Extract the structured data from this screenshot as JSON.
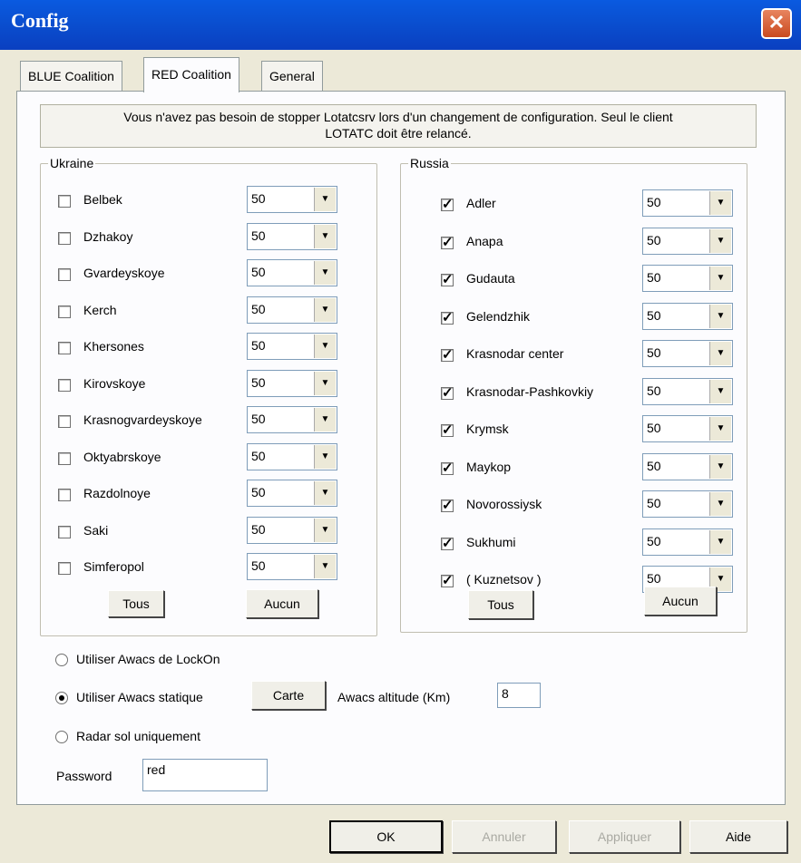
{
  "window": {
    "title": "Config",
    "close_glyph": "✕"
  },
  "tabs": [
    {
      "label": "BLUE Coalition",
      "active": false
    },
    {
      "label": "RED Coalition",
      "active": true
    },
    {
      "label": "General",
      "active": false
    }
  ],
  "info_text_line1": "Vous n'avez pas besoin de stopper Lotatcsrv lors d'un changement de configuration. Seul le client",
  "info_text_line2": "LOTATC doit être relancé.",
  "ukraine": {
    "legend": "Ukraine",
    "items": [
      {
        "label": "Belbek",
        "checked": false,
        "value": "50"
      },
      {
        "label": "Dzhakoy",
        "checked": false,
        "value": "50"
      },
      {
        "label": "Gvardeyskoye",
        "checked": false,
        "value": "50"
      },
      {
        "label": "Kerch",
        "checked": false,
        "value": "50"
      },
      {
        "label": "Khersones",
        "checked": false,
        "value": "50"
      },
      {
        "label": "Kirovskoye",
        "checked": false,
        "value": "50"
      },
      {
        "label": "Krasnogvardeyskoye",
        "checked": false,
        "value": "50"
      },
      {
        "label": "Oktyabrskoye",
        "checked": false,
        "value": "50"
      },
      {
        "label": "Razdolnoye",
        "checked": false,
        "value": "50"
      },
      {
        "label": "Saki",
        "checked": false,
        "value": "50"
      },
      {
        "label": "Simferopol",
        "checked": false,
        "value": "50"
      }
    ],
    "all_button": "Tous",
    "none_button": "Aucun"
  },
  "russia": {
    "legend": "Russia",
    "items": [
      {
        "label": "Adler",
        "checked": true,
        "value": "50"
      },
      {
        "label": "Anapa",
        "checked": true,
        "value": "50"
      },
      {
        "label": "Gudauta",
        "checked": true,
        "value": "50"
      },
      {
        "label": "Gelendzhik",
        "checked": true,
        "value": "50"
      },
      {
        "label": "Krasnodar center",
        "checked": true,
        "value": "50"
      },
      {
        "label": "Krasnodar-Pashkovkiy",
        "checked": true,
        "value": "50"
      },
      {
        "label": "Krymsk",
        "checked": true,
        "value": "50"
      },
      {
        "label": "Maykop",
        "checked": true,
        "value": "50"
      },
      {
        "label": "Novorossiysk",
        "checked": true,
        "value": "50"
      },
      {
        "label": "Sukhumi",
        "checked": true,
        "value": "50"
      },
      {
        "label": "( Kuznetsov )",
        "checked": true,
        "value": "50"
      }
    ],
    "all_button": "Tous",
    "none_button": "Aucun"
  },
  "options": {
    "radio_lockon": "Utiliser Awacs de LockOn",
    "radio_static": "Utiliser Awacs statique",
    "radio_ground": "Radar sol uniquement",
    "selected": "static",
    "map_button": "Carte",
    "altitude_label": "Awacs altitude (Km)",
    "altitude_value": "8",
    "password_label": "Password",
    "password_value": "red"
  },
  "footer": {
    "ok": "OK",
    "cancel": "Annuler",
    "apply": "Appliquer",
    "help": "Aide"
  },
  "check_glyph": "✓",
  "arrow_glyph": "▼"
}
